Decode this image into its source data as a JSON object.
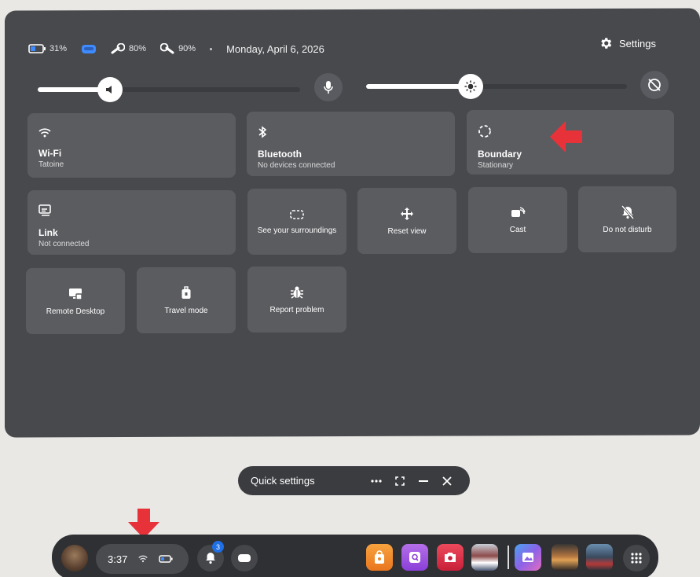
{
  "status": {
    "battery_headset": "31%",
    "controller_left": "80%",
    "controller_right": "90%",
    "date": "Monday, April 6, 2026"
  },
  "settings_label": "Settings",
  "sliders": {
    "volume_level": 0.3,
    "brightness_level": 0.4
  },
  "tiles": {
    "wifi": {
      "title": "Wi-Fi",
      "sub": "Tatoine"
    },
    "bluetooth": {
      "title": "Bluetooth",
      "sub": "No devices connected"
    },
    "boundary": {
      "title": "Boundary",
      "sub": "Stationary"
    },
    "link": {
      "title": "Link",
      "sub": "Not connected"
    },
    "surroundings": "See your surroundings",
    "reset_view": "Reset view",
    "cast": "Cast",
    "dnd": "Do not disturb",
    "remote_desktop": "Remote Desktop",
    "travel_mode": "Travel mode",
    "report_problem": "Report problem"
  },
  "window_bar": {
    "title": "Quick settings"
  },
  "dock": {
    "time": "3:37",
    "notification_count": "3"
  },
  "colors": {
    "panel": "#48494d",
    "tile": "#5b5c60",
    "accent_blue": "#1f6fe5",
    "arrow_red": "#e8323a"
  }
}
